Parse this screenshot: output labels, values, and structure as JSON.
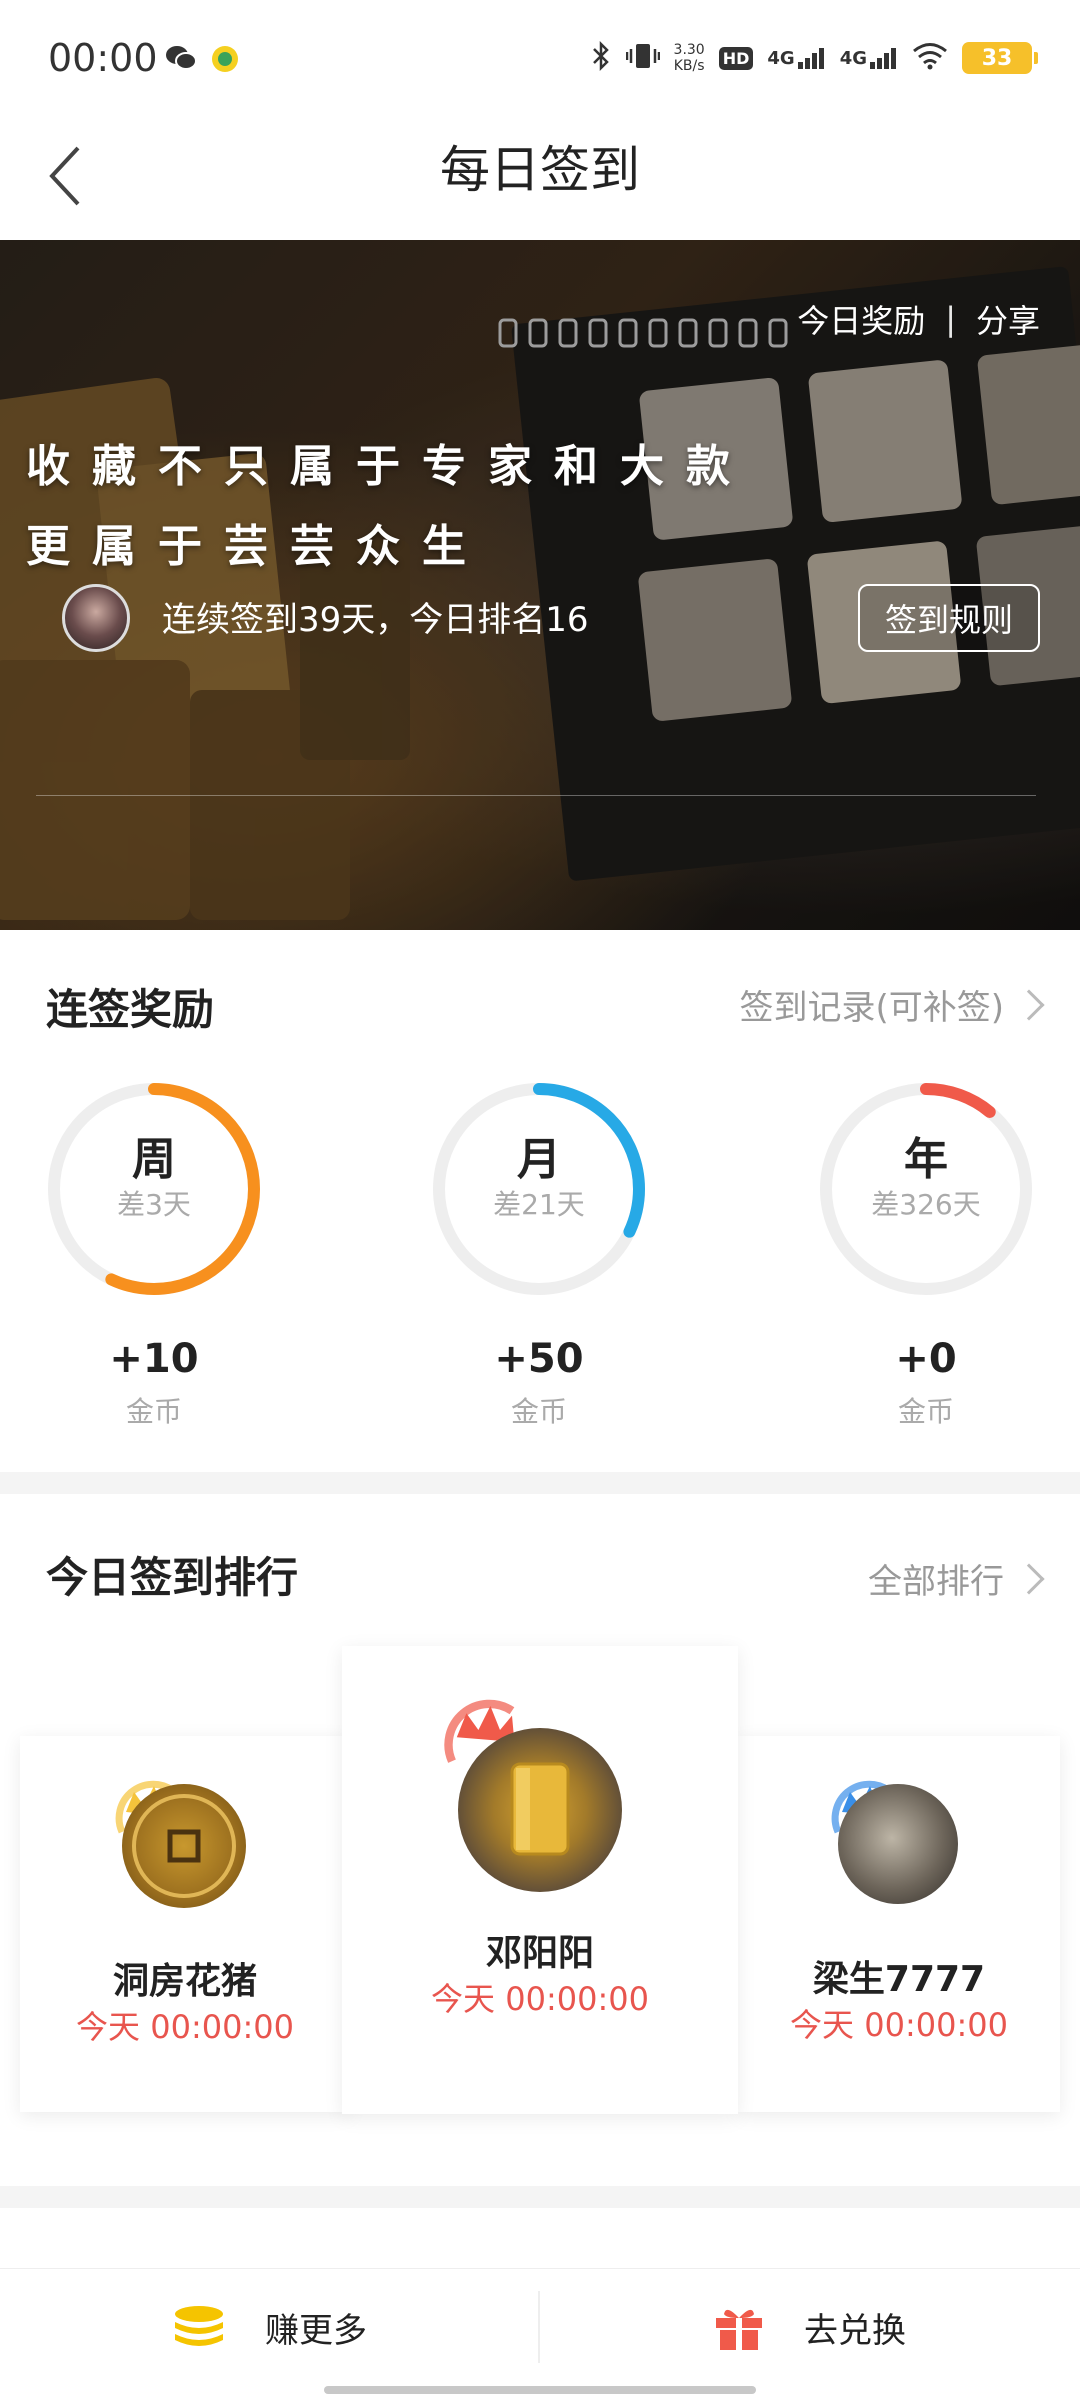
{
  "status_bar": {
    "time": "00:00",
    "speed_top": "3.30",
    "speed_bottom": "KB/s",
    "hd": "HD",
    "net1": "4G",
    "net2": "4G",
    "battery": "33"
  },
  "nav": {
    "title": "每日签到",
    "back_icon": "chevron-left-icon"
  },
  "banner": {
    "today_reward": "今日奖励",
    "divider": "|",
    "share": "分享",
    "slogan_line1": "收藏不只属于专家和大款",
    "slogan_line2": "更属于芸芸众生",
    "streak_text": "连续签到39天，今日排名16",
    "rules_button": "签到规则"
  },
  "streak_rewards": {
    "title": "连签奖励",
    "record_link": "签到记录(可补签)",
    "rings": [
      {
        "label": "周",
        "sub": "差3天",
        "progress": 0.57,
        "color": "#f7901e",
        "reward": "+10",
        "unit": "金币"
      },
      {
        "label": "月",
        "sub": "差21天",
        "progress": 0.32,
        "color": "#27a9e6",
        "reward": "+50",
        "unit": "金币"
      },
      {
        "label": "年",
        "sub": "差326天",
        "progress": 0.11,
        "color": "#f05a4a",
        "reward": "+0",
        "unit": "金币"
      }
    ]
  },
  "ranking": {
    "title": "今日签到排行",
    "all_link": "全部排行",
    "entries": [
      {
        "rank": 2,
        "name": "洞房花猪",
        "time": "今天 00:00:00",
        "crown_color": "#f5c33b"
      },
      {
        "rank": 1,
        "name": "邓阳阳",
        "time": "今天 00:00:00",
        "crown_color": "#f05a4a"
      },
      {
        "rank": 3,
        "name": "梁生7777",
        "time": "今天 00:00:00",
        "crown_color": "#3a8fe8"
      }
    ]
  },
  "bottom_bar": {
    "earn_more": "赚更多",
    "exchange": "去兑换",
    "earn_icon": "coins-stack-icon",
    "exchange_icon": "gift-icon"
  },
  "colors": {
    "accent_red": "#e8554e",
    "coin_yellow": "#f5c400",
    "gift_red": "#f05a4a"
  }
}
